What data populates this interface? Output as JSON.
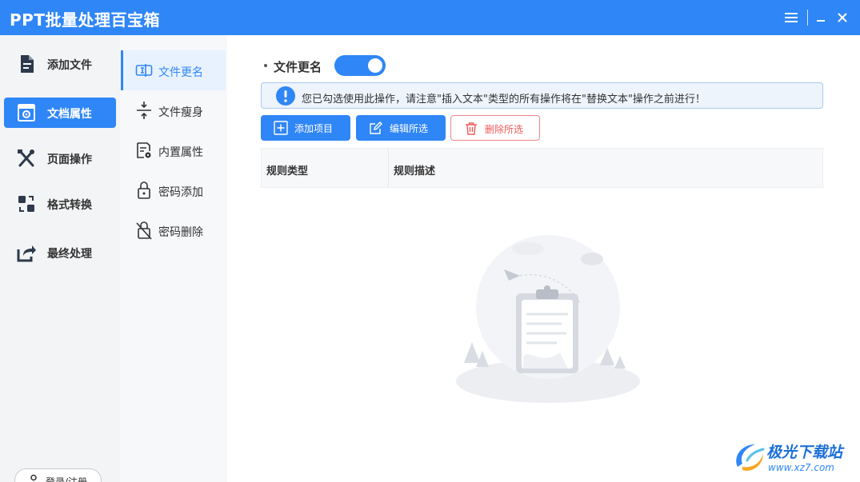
{
  "app": {
    "title": "PPT批量处理百宝箱"
  },
  "window_controls": {
    "menu_icon": "hamburger-icon",
    "minimize_icon": "minimize-icon",
    "close_icon": "close-icon"
  },
  "leftnav": {
    "items": [
      {
        "label": "添加文件",
        "icon": "file-add-icon",
        "active": false
      },
      {
        "label": "文档属性",
        "icon": "doc-settings-icon",
        "active": true
      },
      {
        "label": "页面操作",
        "icon": "tools-icon",
        "active": false
      },
      {
        "label": "格式转换",
        "icon": "convert-icon",
        "active": false
      },
      {
        "label": "最终处理",
        "icon": "share-icon",
        "active": false
      }
    ],
    "login_label": "登录/注册"
  },
  "subnav": {
    "items": [
      {
        "label": "文件更名",
        "icon": "rename-icon",
        "active": true
      },
      {
        "label": "文件瘦身",
        "icon": "compress-icon",
        "active": false
      },
      {
        "label": "内置属性",
        "icon": "properties-icon",
        "active": false
      },
      {
        "label": "密码添加",
        "icon": "lock-icon",
        "active": false
      },
      {
        "label": "密码删除",
        "icon": "unlock-icon",
        "active": false
      }
    ]
  },
  "main": {
    "section_title": "文件更名",
    "toggle_on": true,
    "notice": "您已勾选使用此操作，请注意\"插入文本\"类型的所有操作将在\"替换文本\"操作之前进行！",
    "buttons": {
      "add": "添加项目",
      "edit": "编辑所选",
      "delete": "删除所选"
    },
    "table": {
      "columns": [
        "规则类型",
        "规则描述"
      ],
      "rows": []
    }
  },
  "watermark": {
    "name": "极光下载站",
    "url": "www.xz7.com"
  },
  "colors": {
    "accent": "#2f86f6",
    "danger": "#ee5a5a",
    "sidebar_bg": "#f3f4f6"
  }
}
